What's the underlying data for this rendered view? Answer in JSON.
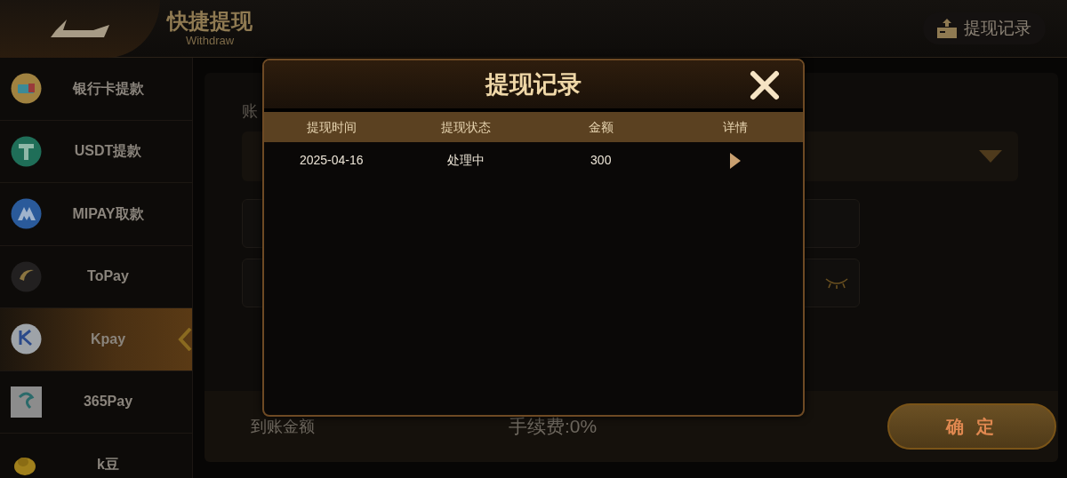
{
  "header": {
    "title": "快捷提现",
    "subtitle": "Withdraw",
    "records_button": "提现记录"
  },
  "sidebar": {
    "items": [
      {
        "label": "银行卡提款",
        "kind": "card",
        "selected": false
      },
      {
        "label": "USDT提款",
        "kind": "tether",
        "selected": false
      },
      {
        "label": "MIPAY取款",
        "kind": "mipay",
        "selected": false
      },
      {
        "label": "ToPay",
        "kind": "topay",
        "selected": false
      },
      {
        "label": "Kpay",
        "kind": "kpay",
        "selected": true
      },
      {
        "label": "365Pay",
        "kind": "pay365",
        "selected": false
      },
      {
        "label": "k豆",
        "kind": "bean",
        "selected": false
      }
    ]
  },
  "form": {
    "account_label": "账"
  },
  "footer": {
    "amount_label": "到账金额",
    "fee": "手续费:0%",
    "confirm_button": "确 定"
  },
  "dialog": {
    "title": "提现记录",
    "columns": [
      "提现时间",
      "提现状态",
      "金额",
      "详情"
    ],
    "rows": [
      {
        "cells": [
          "2025-04-16",
          "处理中",
          "300"
        ]
      }
    ]
  }
}
